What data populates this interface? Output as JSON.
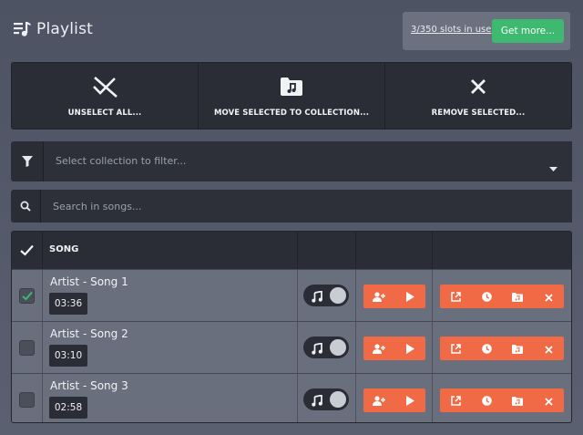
{
  "header": {
    "title": "Playlist",
    "title_icon": "playlist-icon",
    "slots_text": "3/350 slots in use",
    "get_more_label": "Get more..."
  },
  "actions": [
    {
      "label": "UNSELECT ALL...",
      "icon": "unselect-all-icon"
    },
    {
      "label": "MOVE SELECTED TO COLLECTION...",
      "icon": "folder-music-icon"
    },
    {
      "label": "REMOVE SELECTED...",
      "icon": "close-icon"
    }
  ],
  "filter": {
    "placeholder": "Select collection to filter...",
    "icon": "filter-icon",
    "caret_icon": "caret-down-icon"
  },
  "search": {
    "placeholder": "Search in songs...",
    "icon": "search-icon"
  },
  "table": {
    "columns": [
      "",
      "SONG",
      "",
      "",
      ""
    ],
    "rows": [
      {
        "title": "Artist - Song 1",
        "duration": "03:36",
        "selected": true
      },
      {
        "title": "Artist - Song 2",
        "duration": "03:10",
        "selected": false
      },
      {
        "title": "Artist - Song 3",
        "duration": "02:58",
        "selected": false
      }
    ]
  },
  "colors": {
    "background": "#53596a",
    "panel": "#2a2d35",
    "row": "#6a6f7e",
    "accent_green": "#3dba6f",
    "accent_orange": "#f06a45",
    "check_green": "#3dba6f"
  }
}
